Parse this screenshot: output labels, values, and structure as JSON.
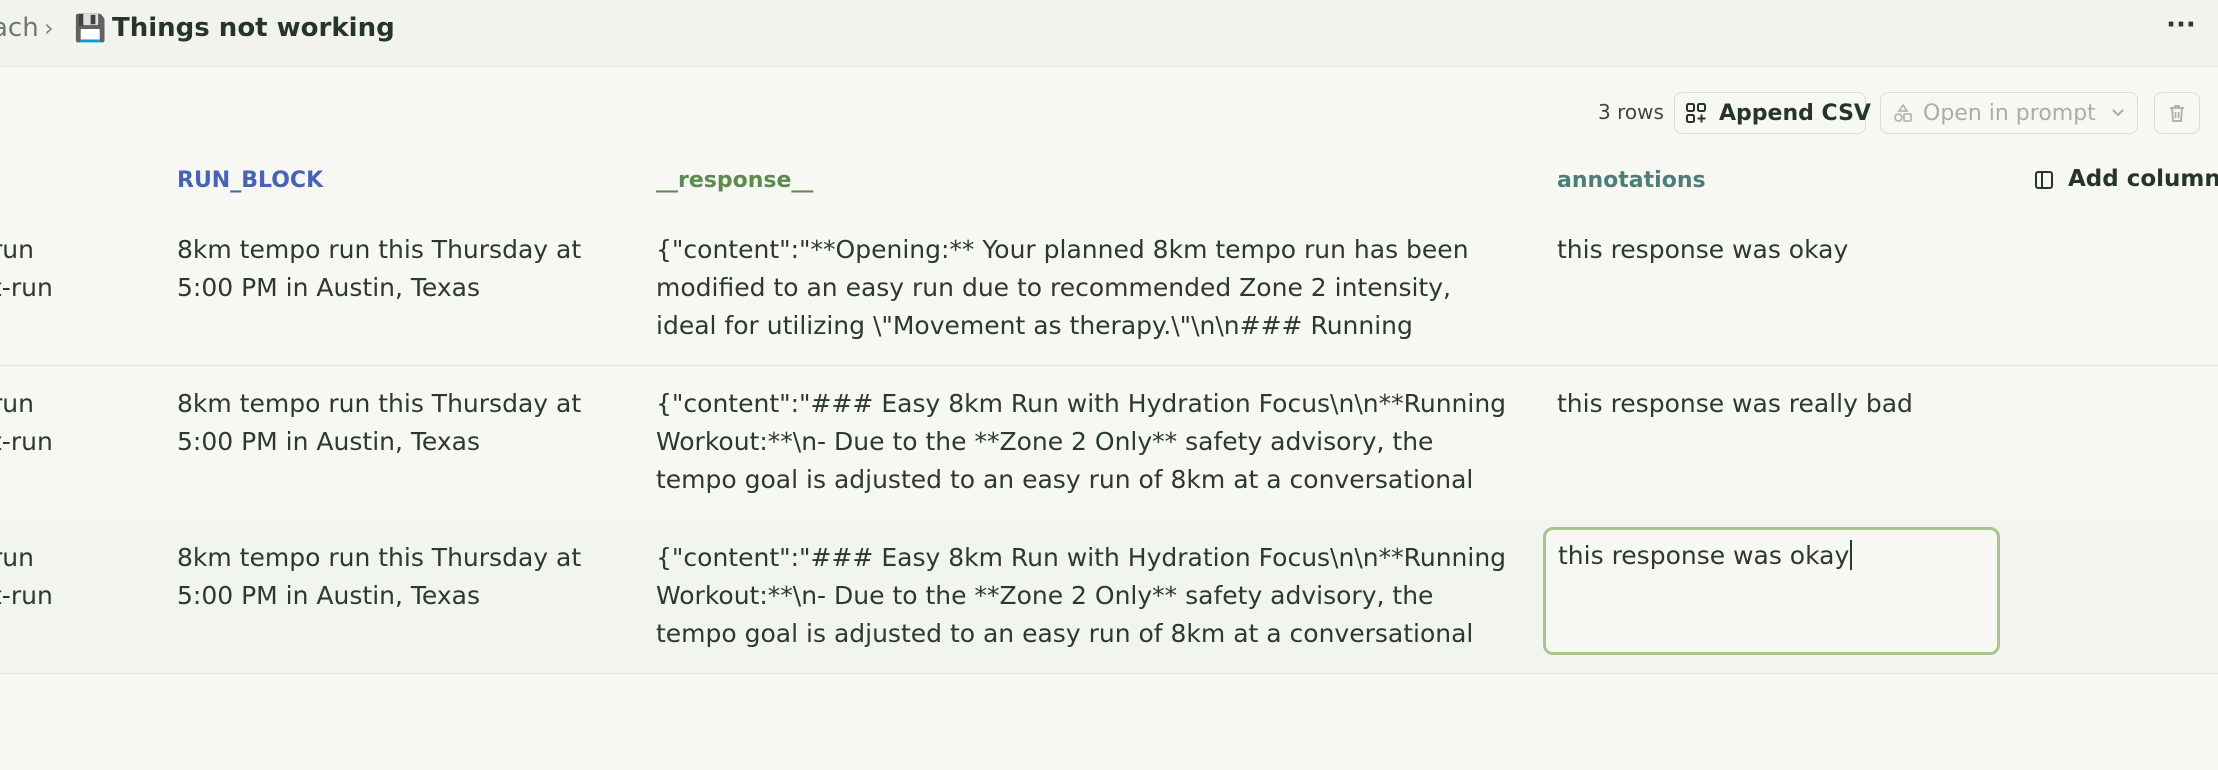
{
  "breadcrumb": {
    "prev": "ach",
    "separator": "›",
    "emoji": "💾",
    "title": "Things not working"
  },
  "header": {
    "more_label": "···"
  },
  "toolbar": {
    "rows_count": "3 rows",
    "append_csv": "Append CSV",
    "open_in_prompt": "Open in prompt"
  },
  "table": {
    "columns": {
      "run_block": "RUN_BLOCK",
      "response": "__response__",
      "annotations": "annotations",
      "add_column": "Add column"
    },
    "rows": [
      {
        "left_line1": "run",
        "left_line2": "t-run",
        "run_block": "8km tempo run this Thursday at 5:00 PM in Austin, Texas",
        "response": "{\"content\":\"**Opening:** Your planned 8km tempo run has been modified to an easy run due to recommended Zone 2 intensity, ideal for utilizing \\\"Movement as therapy.\\\"\\n\\n### Running Workout\\n-",
        "annotation": "this response was okay"
      },
      {
        "left_line1": "run",
        "left_line2": "t-run",
        "run_block": "8km tempo run this Thursday at 5:00 PM in Austin, Texas",
        "response": "{\"content\":\"### Easy 8km Run with Hydration Focus\\n\\n**Running Workout:**\\n- Due to the **Zone 2 Only** safety advisory, the tempo goal is adjusted to an easy run of 8km at a conversational",
        "annotation": "this response was really bad"
      },
      {
        "left_line1": "run",
        "left_line2": "t-run",
        "run_block": "8km tempo run this Thursday at 5:00 PM in Austin, Texas",
        "response": "{\"content\":\"### Easy 8km Run with Hydration Focus\\n\\n**Running Workout:**\\n- Due to the **Zone 2 Only** safety advisory, the tempo goal is adjusted to an easy run of 8km at a conversational",
        "annotation": "this response was okay"
      }
    ]
  },
  "colors": {
    "run_block_header": "#4863b3",
    "response_header": "#5d8a4e",
    "annotations_header": "#4f7d78",
    "editor_border": "#a9c490"
  },
  "icons": {
    "append": "grid-plus-icon",
    "prompt": "shapes-icon",
    "dropdown": "chevron-down-icon",
    "delete": "trash-icon",
    "add_column": "column-panel-icon"
  }
}
